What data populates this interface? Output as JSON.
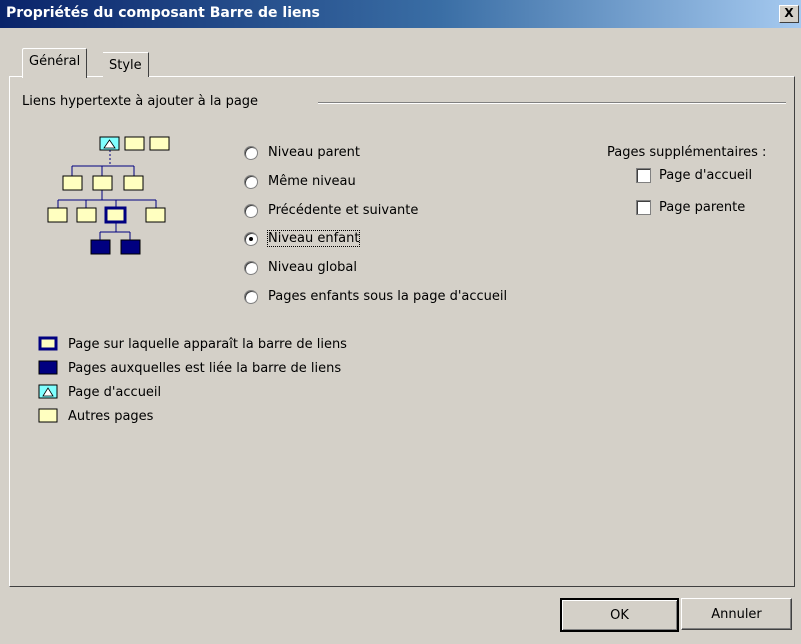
{
  "window": {
    "title": "Propriétés du composant Barre de liens",
    "close_label": "X"
  },
  "tabs": [
    {
      "label": "Général"
    },
    {
      "label": "Style"
    }
  ],
  "group": {
    "label": "Liens hypertexte à ajouter à la page"
  },
  "radios": [
    {
      "label": "Niveau parent",
      "selected": false
    },
    {
      "label": "Même niveau",
      "selected": false
    },
    {
      "label": "Précédente et suivante",
      "selected": false
    },
    {
      "label": "Niveau enfant",
      "selected": true
    },
    {
      "label": "Niveau global",
      "selected": false
    },
    {
      "label": "Pages enfants sous la page d'accueil",
      "selected": false
    }
  ],
  "supplementary": {
    "title": "Pages supplémentaires :",
    "items": [
      {
        "label": "Page d'accueil",
        "checked": false
      },
      {
        "label": "Page parente",
        "checked": false
      }
    ]
  },
  "legend": [
    {
      "label": "Page sur laquelle apparaît la barre de liens",
      "icon": "current-page-icon"
    },
    {
      "label": "Pages auxquelles est liée la barre de liens",
      "icon": "linked-page-icon"
    },
    {
      "label": "Page d'accueil",
      "icon": "home-page-icon"
    },
    {
      "label": "Autres pages",
      "icon": "other-page-icon"
    }
  ],
  "buttons": {
    "ok": "OK",
    "cancel": "Annuler"
  },
  "colors": {
    "title_start": "#0a246a",
    "dialog_bg": "#d4d0c8",
    "page_yellow": "#ffffc0",
    "page_blue": "#000080",
    "home_cyan": "#80ffff"
  }
}
